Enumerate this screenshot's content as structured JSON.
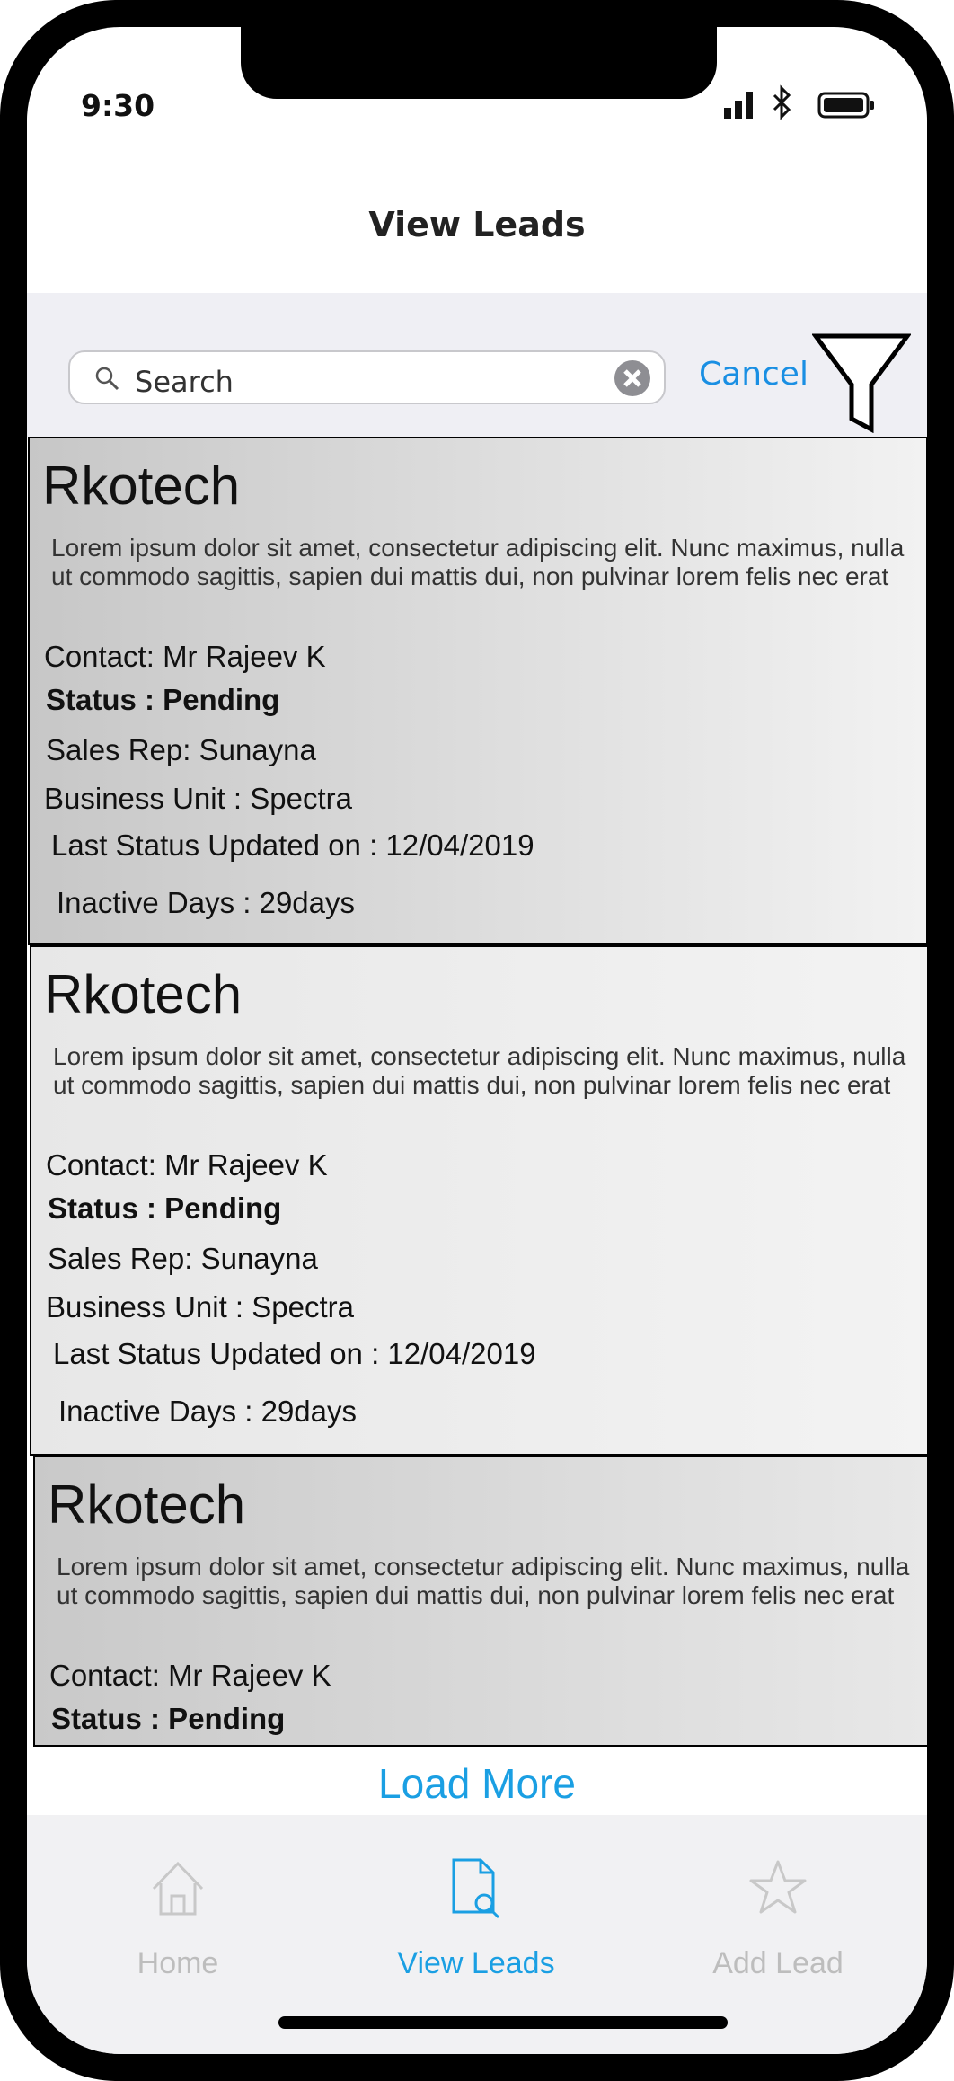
{
  "status_bar": {
    "time": "9:30"
  },
  "header": {
    "title": "View Leads"
  },
  "search": {
    "placeholder": "Search",
    "cancel_label": "Cancel"
  },
  "leads": [
    {
      "company": "Rkotech",
      "description": "Lorem ipsum dolor sit amet, consectetur adipiscing elit. Nunc maximus, nulla ut commodo sagittis, sapien dui mattis dui, non pulvinar lorem felis nec erat",
      "contact": "Contact: Mr Rajeev K",
      "status": "Status : Pending",
      "sales_rep": "Sales Rep: Sunayna",
      "business_unit": "Business Unit : Spectra",
      "last_updated": "Last Status Updated on : 12/04/2019",
      "inactive_days": "Inactive Days : 29days"
    },
    {
      "company": "Rkotech",
      "description": "Lorem ipsum dolor sit amet, consectetur adipiscing elit. Nunc maximus, nulla ut commodo sagittis, sapien dui mattis dui, non pulvinar lorem felis nec erat",
      "contact": "Contact: Mr Rajeev K",
      "status": "Status : Pending",
      "sales_rep": "Sales Rep: Sunayna",
      "business_unit": "Business Unit : Spectra",
      "last_updated": "Last Status Updated on : 12/04/2019",
      "inactive_days": "Inactive Days : 29days"
    },
    {
      "company": "Rkotech",
      "description": "Lorem ipsum dolor sit amet, consectetur adipiscing elit. Nunc maximus, nulla ut commodo sagittis, sapien dui mattis dui, non pulvinar lorem felis nec erat",
      "contact": "Contact: Mr Rajeev K",
      "status": "Status : Pending"
    }
  ],
  "load_more_label": "Load More",
  "tab_bar": {
    "tabs": [
      {
        "label": "Home",
        "icon": "home-icon",
        "active": false
      },
      {
        "label": "View Leads",
        "icon": "document-search-icon",
        "active": true
      },
      {
        "label": "Add Lead",
        "icon": "star-icon",
        "active": false
      }
    ],
    "active_color": "#1a9fe3",
    "inactive_color": "#bdbdbd"
  },
  "colors": {
    "accent": "#1a8fe3"
  }
}
